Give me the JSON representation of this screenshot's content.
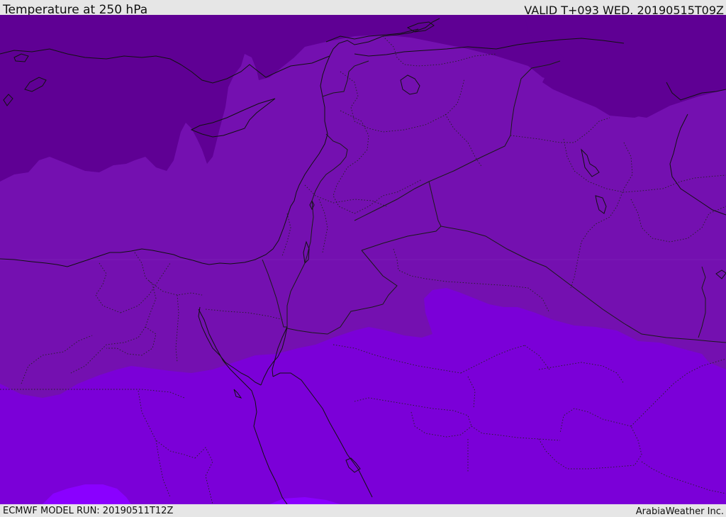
{
  "header": {
    "title": "Temperature at 250 hPa",
    "valid_time": "VALID T+093 WED. 20190515T09Z"
  },
  "footer": {
    "model_run": "ECMWF MODEL RUN: 20190511T12Z",
    "credit": "ArabiaWeather Inc."
  },
  "map": {
    "field": "Temperature",
    "level": "250 hPa",
    "colors": {
      "coldest_band": "#5f0094",
      "cold_band": "#7410b0",
      "mid_band": "#7b00d8",
      "warm_band": "#8a00ff",
      "coastline": "#111111",
      "border": "#1a1a1a",
      "internal_border": "#222222"
    }
  }
}
